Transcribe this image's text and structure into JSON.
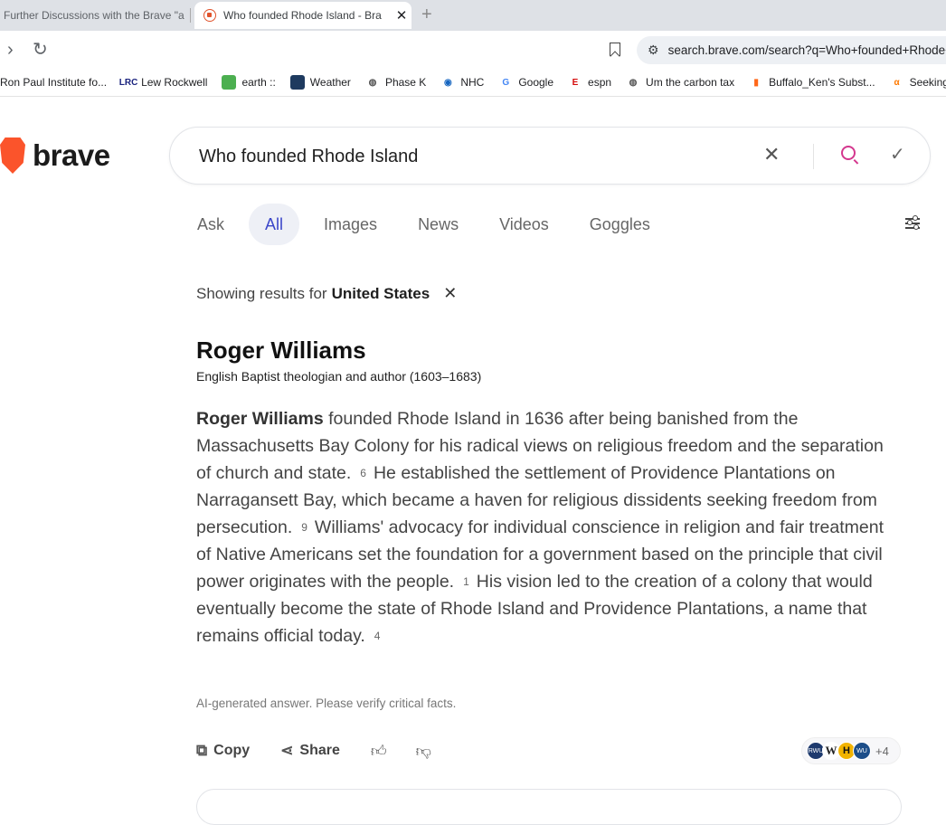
{
  "browser": {
    "tabs": [
      {
        "title": "Further Discussions with the Brave \"a",
        "active": false
      },
      {
        "title": "Who founded Rhode Island - Bra",
        "active": true
      }
    ],
    "close_glyph": "✕",
    "new_tab_glyph": "+",
    "url": "search.brave.com/search?q=Who+founded+Rhode+Island",
    "bookmarks": [
      {
        "label": "Ron Paul Institute fo...",
        "icon": "",
        "color": "#ffffff"
      },
      {
        "label": "Lew Rockwell",
        "icon": "LRC",
        "color": "#1a237e"
      },
      {
        "label": "earth ::",
        "icon": "",
        "color": "#4caf50"
      },
      {
        "label": "Weather",
        "icon": "",
        "color": "#1e3a5f"
      },
      {
        "label": "Phase K",
        "icon": "◍",
        "color": "#555555"
      },
      {
        "label": "NHC",
        "icon": "◉",
        "color": "#1565c0"
      },
      {
        "label": "Google",
        "icon": "G",
        "color": "#4285f4"
      },
      {
        "label": "espn",
        "icon": "E",
        "color": "#d50a0a"
      },
      {
        "label": "Um the carbon tax",
        "icon": "◍",
        "color": "#555555"
      },
      {
        "label": "Buffalo_Ken's Subst...",
        "icon": "▮",
        "color": "#ff6719"
      },
      {
        "label": "Seeking A",
        "icon": "α",
        "color": "#ff7a00"
      }
    ]
  },
  "brand": {
    "wordmark": "brave",
    "accent": "#fb542b"
  },
  "search": {
    "query": "Who founded Rhode Island"
  },
  "nav_tabs": [
    "Ask",
    "All",
    "Images",
    "News",
    "Videos",
    "Goggles"
  ],
  "active_tab": "All",
  "region": {
    "prefix": "Showing results for",
    "value": "United States"
  },
  "entity": {
    "title": "Roger Williams",
    "subtitle": "English Baptist theologian and author (1603–1683)"
  },
  "answer": {
    "lead": "Roger Williams",
    "p1": " founded Rhode Island in 1636 after being banished from the Massachusetts Bay Colony for his radical views on religious freedom and the separation of church and state.",
    "c1": "6",
    "p2": "He established the settlement of Providence Plantations on Narragansett Bay, which became a haven for religious dissidents seeking freedom from persecution.",
    "c2": "9",
    "p3": "Williams' advocacy for individual conscience in religion and fair treatment of Native Americans set the foundation for a government based on the principle that civil power originates with the people.",
    "c3": "1",
    "p4": "His vision led to the creation of a colony that would eventually become the state of Rhode Island and Providence Plantations, a name that remains official today.",
    "c4": "4"
  },
  "disclaimer": "AI-generated answer. Please verify critical facts.",
  "actions": {
    "copy": "Copy",
    "share": "Share"
  },
  "sources": {
    "badges": [
      "RWU",
      "W",
      "H",
      "WU"
    ],
    "more": "+4"
  }
}
